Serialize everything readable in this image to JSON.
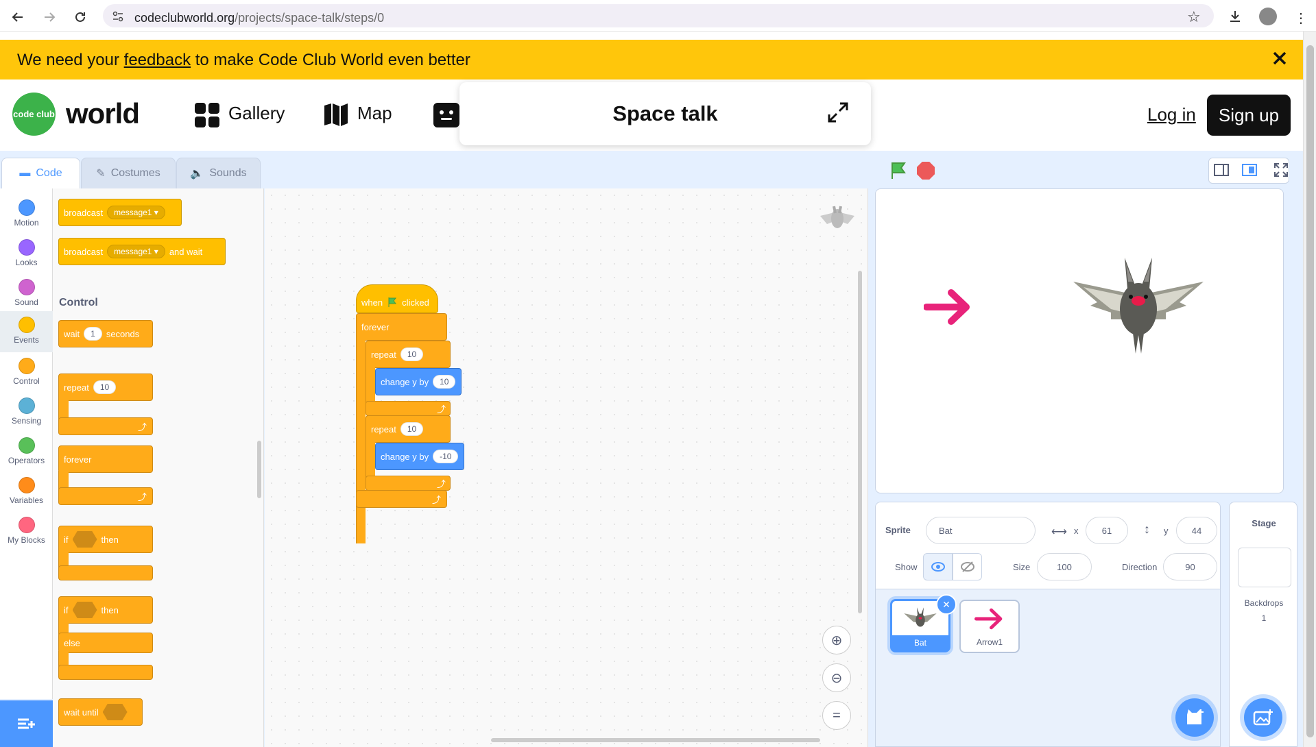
{
  "browser": {
    "url_host": "codeclubworld.org",
    "url_path": "/projects/space-talk/steps/0"
  },
  "banner": {
    "text_before": "We need your ",
    "link": "feedback",
    "text_after": " to make Code Club World even better"
  },
  "header": {
    "logo_text": "code club",
    "logo_word": "world",
    "nav": [
      "Gallery",
      "Map"
    ],
    "popup_title": "Space talk",
    "login": "Log in",
    "signup": "Sign up"
  },
  "editor": {
    "tabs": [
      "Code",
      "Costumes",
      "Sounds"
    ],
    "categories": [
      {
        "label": "Motion",
        "color": "#4c97ff"
      },
      {
        "label": "Looks",
        "color": "#9966ff"
      },
      {
        "label": "Sound",
        "color": "#cf63cf"
      },
      {
        "label": "Events",
        "color": "#ffbf00"
      },
      {
        "label": "Control",
        "color": "#ffab19"
      },
      {
        "label": "Sensing",
        "color": "#5cb1d6"
      },
      {
        "label": "Operators",
        "color": "#59c059"
      },
      {
        "label": "Variables",
        "color": "#ff8c1a"
      },
      {
        "label": "My Blocks",
        "color": "#ff6680"
      }
    ],
    "palette": {
      "broadcast": "broadcast",
      "message": "message1",
      "and_wait": "and wait",
      "control_heading": "Control",
      "wait": "wait",
      "wait_value": "1",
      "seconds": "seconds",
      "repeat": "repeat",
      "repeat_value": "10",
      "forever": "forever",
      "if": "if",
      "then": "then",
      "else": "else",
      "wait_until": "wait until"
    },
    "script": {
      "when": "when",
      "clicked": "clicked",
      "forever": "forever",
      "repeat": "repeat",
      "repeat1_value": "10",
      "change_y": "change y by",
      "change1_value": "10",
      "repeat2_value": "10",
      "change2_value": "-10"
    }
  },
  "sprite": {
    "sprite_label": "Sprite",
    "name": "Bat",
    "x_label": "x",
    "x": "61",
    "y_label": "y",
    "y": "44",
    "show_label": "Show",
    "size_label": "Size",
    "size": "100",
    "direction_label": "Direction",
    "direction": "90",
    "sprites": [
      "Bat",
      "Arrow1"
    ]
  },
  "stage_panel": {
    "title": "Stage",
    "backdrops_label": "Backdrops",
    "backdrops_count": "1"
  }
}
